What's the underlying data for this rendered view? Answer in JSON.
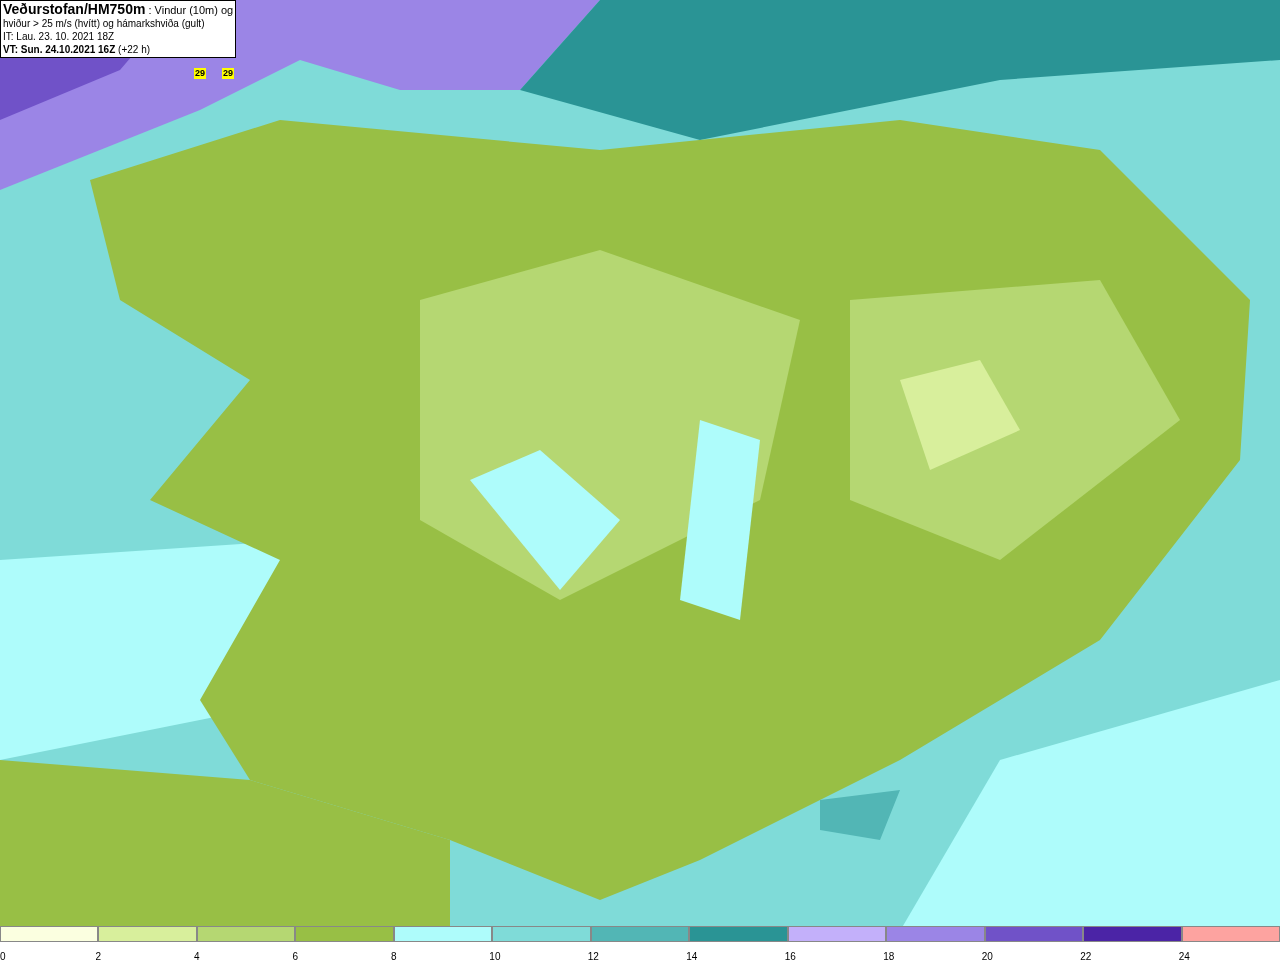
{
  "header": {
    "lines": [
      "**Veðurstofan/HM750m** : Vindur (10m) og",
      "hviður > 25 m/s (hvítt) og hámarkshviða (gult)",
      "IT: Lau. 23. 10. 2021 18Z",
      "**VT: Sun. 24.10.2021 16Z** (+22 h)"
    ]
  },
  "map": {
    "gust_labels": [
      "29",
      "29"
    ]
  },
  "legend": [
    {
      "label": "0",
      "color": "#fbffe0"
    },
    {
      "label": "2",
      "color": "#d8ef9c"
    },
    {
      "label": "4",
      "color": "#b5d772"
    },
    {
      "label": "6",
      "color": "#98bf45"
    },
    {
      "label": "8",
      "color": "#aefcfb"
    },
    {
      "label": "10",
      "color": "#7fdbd8"
    },
    {
      "label": "12",
      "color": "#52b6b5"
    },
    {
      "label": "14",
      "color": "#2a9495"
    },
    {
      "label": "16",
      "color": "#c3b0fa"
    },
    {
      "label": "18",
      "color": "#9b85e6"
    },
    {
      "label": "20",
      "color": "#7052c8"
    },
    {
      "label": "22",
      "color": "#4b24a6"
    },
    {
      "label": "24",
      "color": "#fda3a0"
    }
  ]
}
